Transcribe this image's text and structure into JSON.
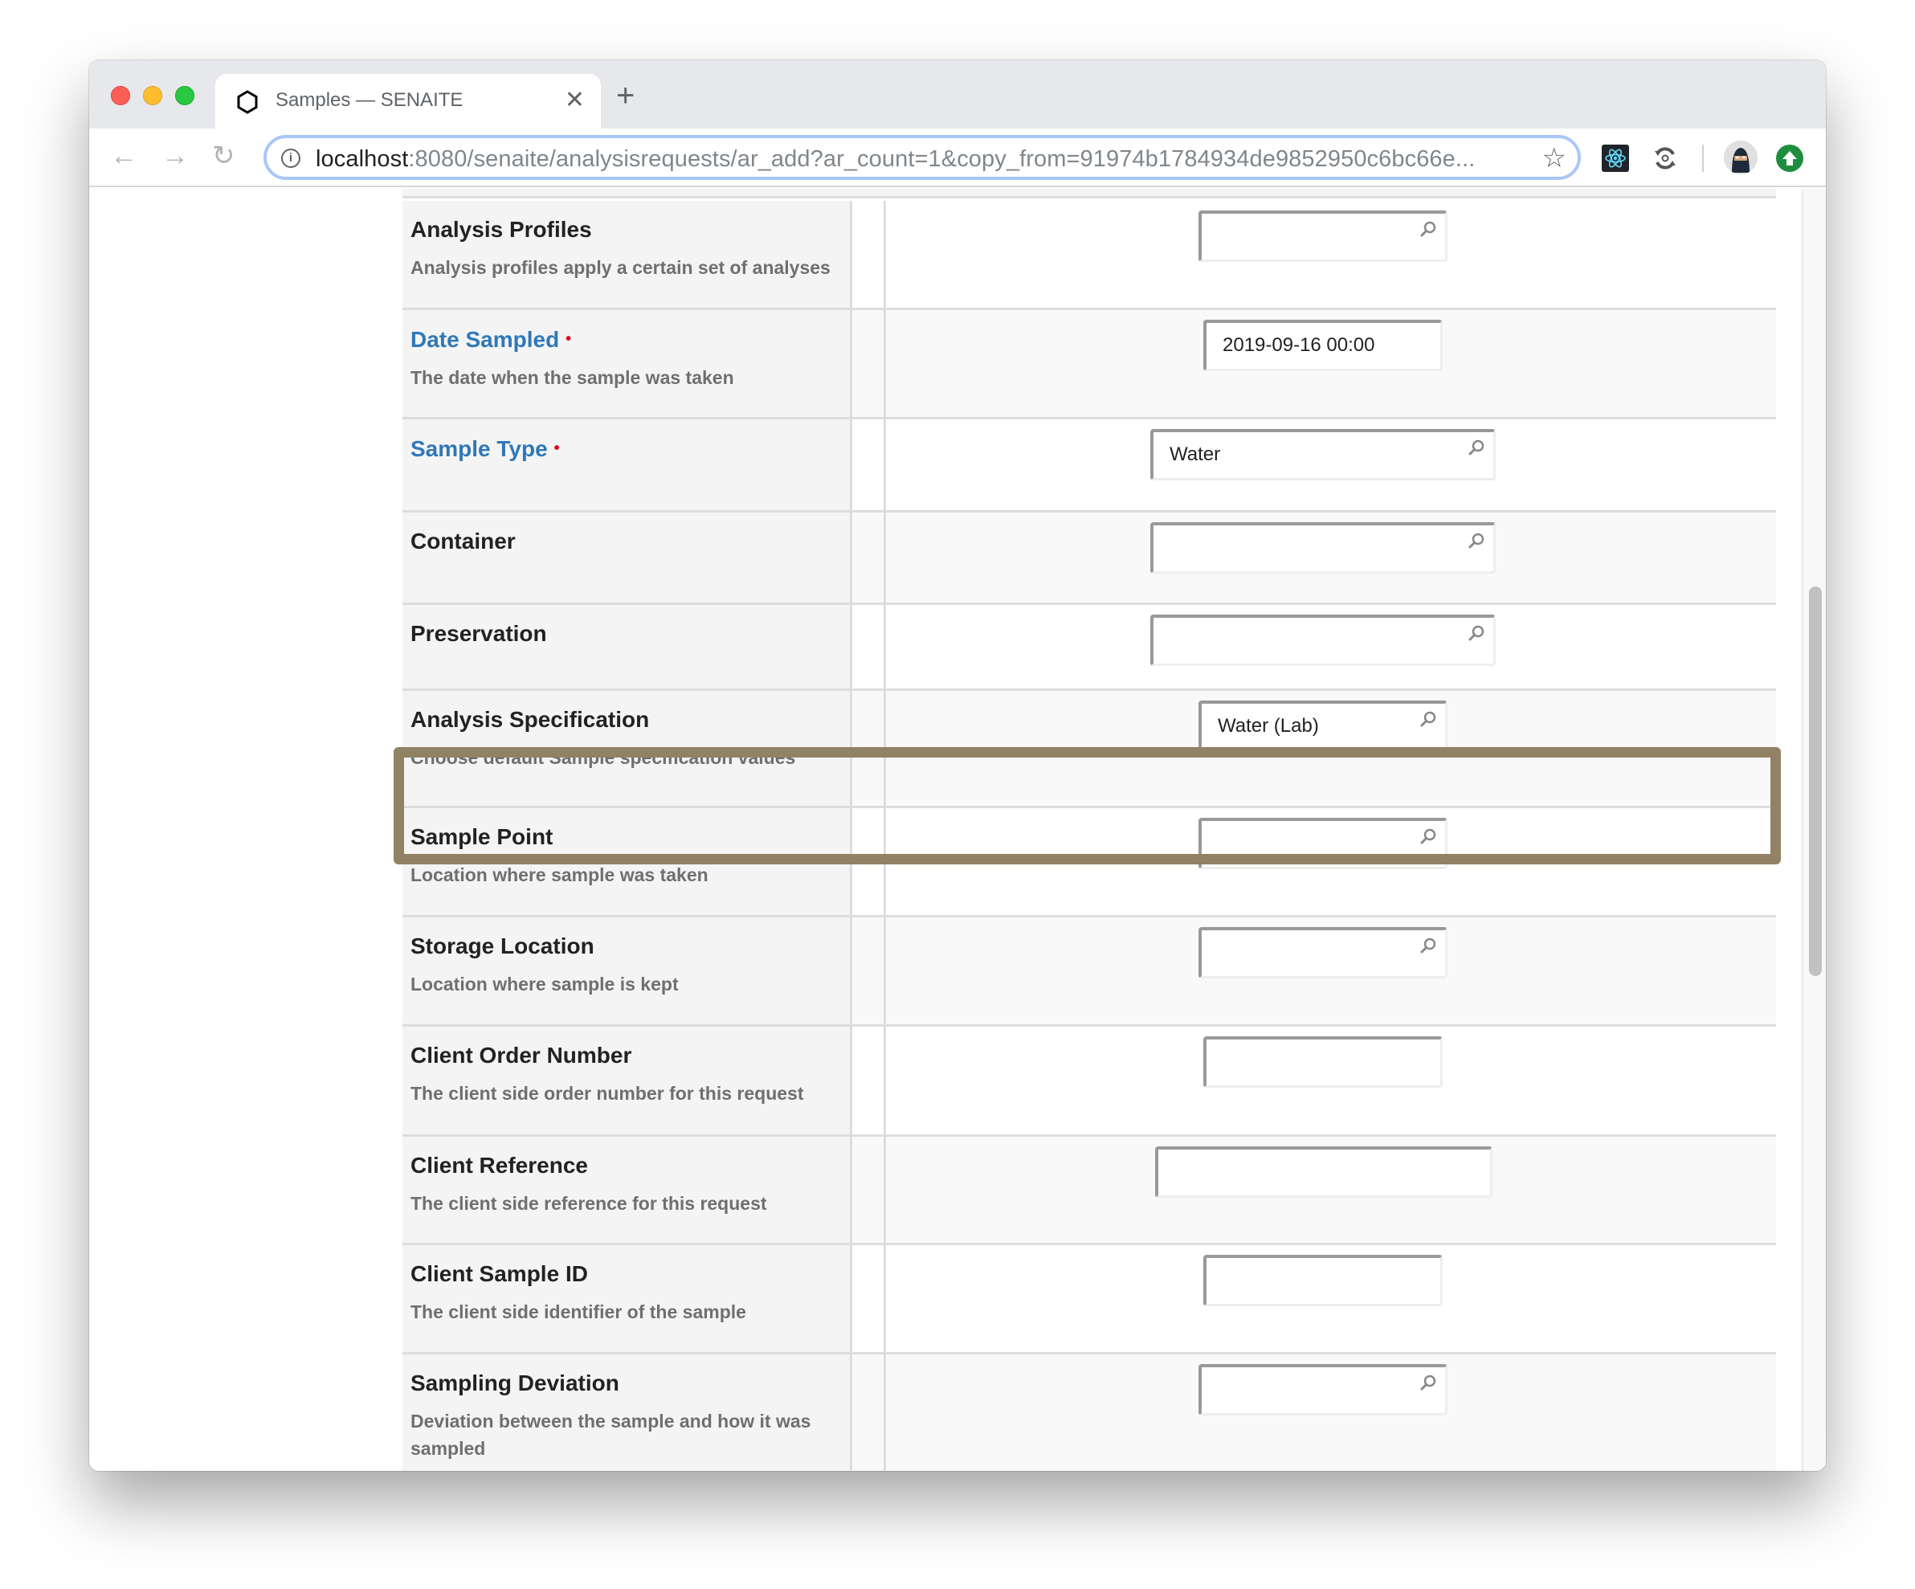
{
  "browser": {
    "tab_title": "Samples — SENAITE",
    "tab_close_glyph": "✕",
    "new_tab_glyph": "+",
    "url_host": "localhost",
    "url_rest": ":8080/senaite/analysisrequests/ar_add?ar_count=1&copy_from=91974b1784934de9852950c6bc66e...",
    "back_glyph": "←",
    "forward_glyph": "→",
    "reload_glyph": "↻",
    "info_glyph": "i",
    "star_glyph": "☆",
    "extensions": [
      "react-devtools-icon",
      "sync-extension-icon"
    ],
    "profile_icon": "ninja-avatar-icon",
    "update_icon": "update-arrow-icon"
  },
  "form": {
    "rows": [
      {
        "title": "Analysis Profiles",
        "help": "Analysis profiles apply a certain set of analyses",
        "required": false,
        "value": "",
        "lookup": true
      },
      {
        "title": "Date Sampled",
        "help": "The date when the sample was taken",
        "required": true,
        "value": "2019-09-16 00:00",
        "lookup": false
      },
      {
        "title": "Sample Type",
        "help": "",
        "required": true,
        "value": "Water",
        "lookup": true
      },
      {
        "title": "Container",
        "help": "",
        "required": false,
        "value": "",
        "lookup": true
      },
      {
        "title": "Preservation",
        "help": "",
        "required": false,
        "value": "",
        "lookup": true
      },
      {
        "title": "Analysis Specification",
        "help": "Choose default Sample specification values",
        "required": false,
        "value": "Water (Lab)",
        "lookup": true,
        "highlighted": true
      },
      {
        "title": "Sample Point",
        "help": "Location where sample was taken",
        "required": false,
        "value": "",
        "lookup": true
      },
      {
        "title": "Storage Location",
        "help": "Location where sample is kept",
        "required": false,
        "value": "",
        "lookup": true
      },
      {
        "title": "Client Order Number",
        "help": "The client side order number for this request",
        "required": false,
        "value": "",
        "lookup": false
      },
      {
        "title": "Client Reference",
        "help": "The client side reference for this request",
        "required": false,
        "value": "",
        "lookup": false
      },
      {
        "title": "Client Sample ID",
        "help": "The client side identifier of the sample",
        "required": false,
        "value": "",
        "lookup": false
      },
      {
        "title": "Sampling Deviation",
        "help": "Deviation between the sample and how it was sampled",
        "required": false,
        "value": "",
        "lookup": true
      }
    ],
    "required_marker": "•"
  },
  "colors": {
    "highlight_border": "#918263",
    "required_title": "#2f78b8",
    "required_dot": "#e2001a"
  }
}
